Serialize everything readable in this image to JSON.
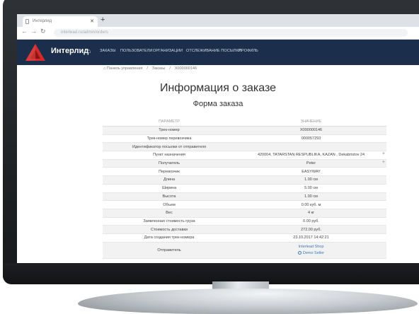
{
  "browser": {
    "tab_title": "Интерлид",
    "url": "interlead.ru/admin/orders"
  },
  "navbar": {
    "brand": "Интерлид",
    "items": [
      "ЗАКАЗЫ",
      "ПОЛЬЗОВАТЕЛИ",
      "ОРГАНИЗАЦИИ",
      "ОТСЛЕЖИВАНИЕ ПОСЫЛКИ",
      "ПРОФИЛЬ"
    ],
    "color": "#1b2f4c",
    "logo_color": "#d32b2b"
  },
  "breadcrumb": [
    "Панель управления",
    "Заказы",
    "X000000146"
  ],
  "page_title": "Информация о заказе",
  "form_title": "Форма заказа",
  "table": {
    "headers": [
      "ПАРАМЕТР",
      "ЗНАЧЕНИЕ"
    ],
    "rows": [
      {
        "param": "Трек-номер",
        "value": "X000000146"
      },
      {
        "param": "Трек-номер перевозчика",
        "value": "000057293"
      },
      {
        "param": "Идентификатор посылки от отправителя",
        "value": ""
      },
      {
        "param": "Пункт назначения",
        "value": "420004, TATARSTAN RESPUBLIKA, KAZAN , Dekabristov 24"
      },
      {
        "param": "Получатель",
        "value": "Peter"
      },
      {
        "param": "Перевозчик",
        "value": "EASYWAY"
      },
      {
        "param": "Длина",
        "value": "1.00 см"
      },
      {
        "param": "Ширина",
        "value": "5.00 см"
      },
      {
        "param": "Высота",
        "value": "1.00 см"
      },
      {
        "param": "Объем",
        "value": "0.00 куб. м"
      },
      {
        "param": "Вес",
        "value": "4 кг"
      },
      {
        "param": "Заявленная стоимость груза",
        "value": "0.00 руб."
      },
      {
        "param": "Стоимость доставки",
        "value": "272.00 руб."
      },
      {
        "param": "Дата создания трек-номера",
        "value": "23.10.2017 14:42:21"
      }
    ],
    "sender": {
      "param": "Отправитель",
      "shop": "Interlead Shop",
      "seller": "Demo Seller"
    }
  }
}
